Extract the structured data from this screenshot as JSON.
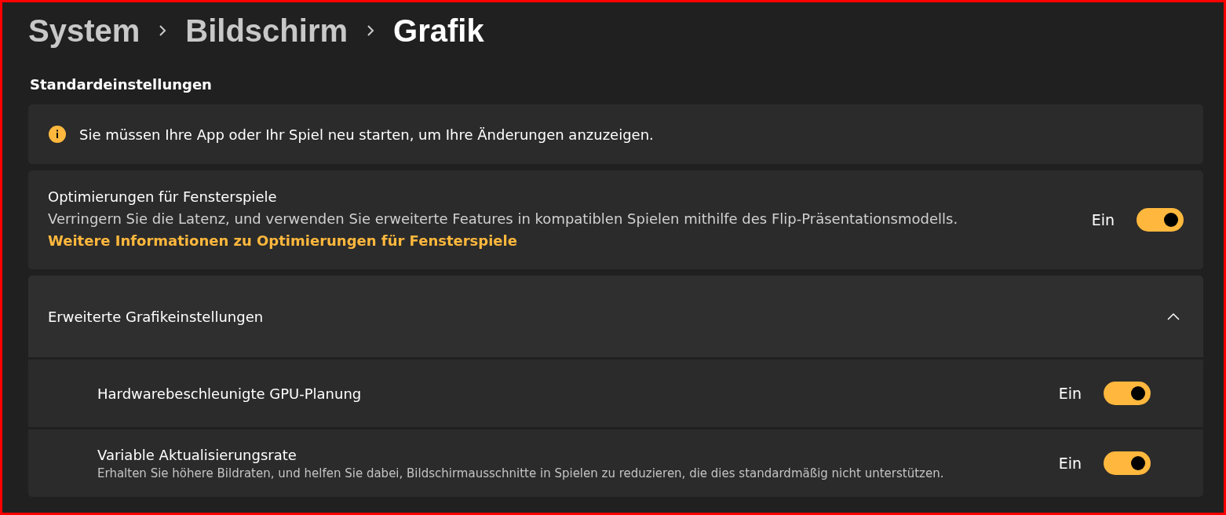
{
  "breadcrumb": [
    {
      "label": "System",
      "current": false
    },
    {
      "label": "Bildschirm",
      "current": false
    },
    {
      "label": "Grafik",
      "current": true
    }
  ],
  "section_title": "Standardeinstellungen",
  "info_banner": {
    "text": "Sie müssen Ihre App oder Ihr Spiel neu starten, um Ihre Änderungen anzuzeigen."
  },
  "settings": [
    {
      "kind": "toggle",
      "title": "Optimierungen für Fensterspiele",
      "description": "Verringern Sie die Latenz, und verwenden Sie erweiterte Features in kompatiblen Spielen mithilfe des Flip-Präsentationsmodells.",
      "link": "Weitere Informationen zu Optimierungen für Fensterspiele",
      "state_label": "Ein",
      "on": true
    }
  ],
  "expander": {
    "title": "Erweiterte Grafikeinstellungen",
    "expanded": true,
    "items": [
      {
        "title": "Hardwarebeschleunigte GPU-Planung",
        "state_label": "Ein",
        "on": true
      },
      {
        "title": "Variable Aktualisierungsrate",
        "description": "Erhalten Sie höhere Bildraten, und helfen Sie dabei, Bildschirmausschnitte in Spielen zu reduzieren, die dies standardmäßig nicht unterstützen.",
        "state_label": "Ein",
        "on": true
      }
    ]
  }
}
